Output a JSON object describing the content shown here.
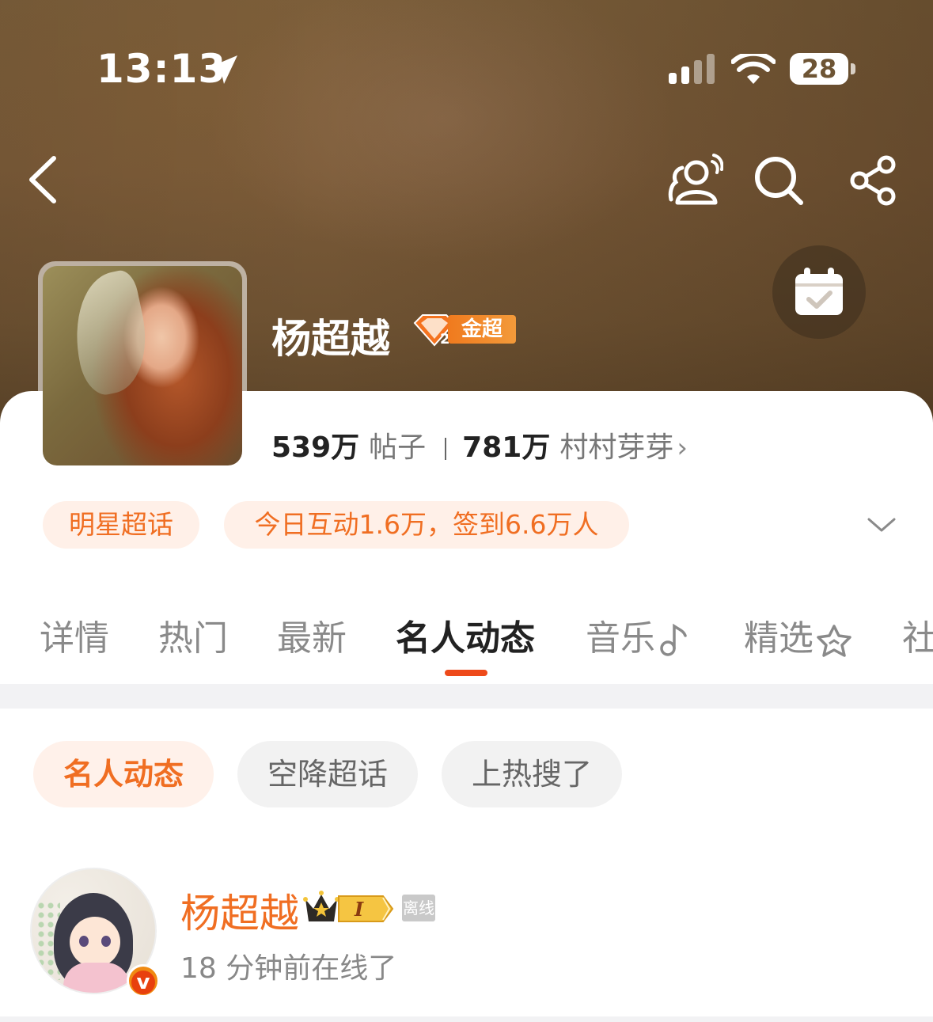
{
  "status_bar": {
    "time": "13:13",
    "battery": "28"
  },
  "profile": {
    "name": "杨超越",
    "badge_label": "金超",
    "posts_count": "539万",
    "posts_label": "帖子",
    "followers_count": "781万",
    "followers_label": "村村芽芽"
  },
  "pills": {
    "category": "明星超话",
    "today_stats": "今日互动1.6万，签到6.6万人"
  },
  "tabs": [
    "详情",
    "热门",
    "最新",
    "名人动态",
    "音乐",
    "精选",
    "社"
  ],
  "active_tab": "名人动态",
  "filter_chips": [
    "名人动态",
    "空降超话",
    "上热搜了"
  ],
  "user_card": {
    "name": "杨超越",
    "level": "I",
    "status_tag": "离线",
    "last_online": "18 分钟前在线了"
  },
  "colors": {
    "accent": "#f06e22",
    "tab_underline": "#ee4a1a",
    "header_brown": "#7a5a38"
  }
}
